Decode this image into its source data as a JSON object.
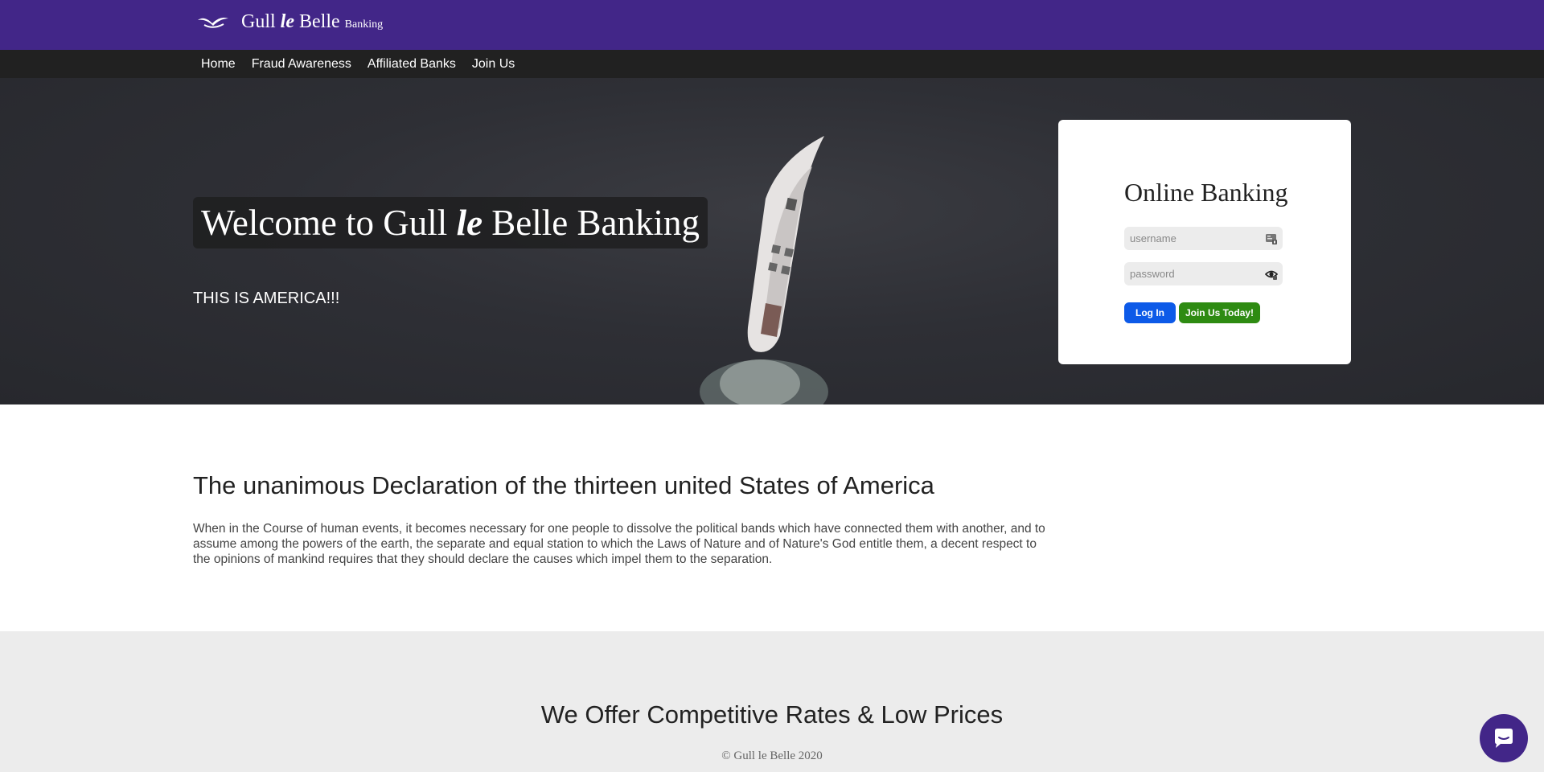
{
  "brand": {
    "name_part1": "Gull ",
    "name_le": "le",
    "name_part2": " Belle",
    "sub": "Banking"
  },
  "nav": {
    "items": [
      "Home",
      "Fraud Awareness",
      "Affiliated Banks",
      "Join Us"
    ]
  },
  "hero": {
    "welcome_part1": "Welcome to Gull ",
    "welcome_le": "le",
    "welcome_part2": " Belle Banking",
    "tagline": "THIS IS AMERICA!!!"
  },
  "login": {
    "title": "Online Banking",
    "username_placeholder": "username",
    "password_placeholder": "password",
    "login_label": "Log In",
    "join_label": "Join Us Today!"
  },
  "declaration": {
    "title": "The unanimous Declaration of the thirteen united States of America",
    "body": "When in the Course of human events, it becomes necessary for one people to dissolve the political bands which have connected them with another, and to assume among the powers of the earth, the separate and equal station to which the Laws of Nature and of Nature's God entitle them, a decent respect to the opinions of mankind requires that they should declare the causes which impel them to the separation."
  },
  "offer": {
    "title": "We Offer Competitive Rates & Low Prices",
    "copyright": "© Gull le Belle 2020"
  },
  "colors": {
    "brand_purple": "#422688",
    "nav_dark": "#212121",
    "login_blue": "#0d5ae8",
    "join_green": "#2e8b12"
  },
  "icons": {
    "brand": "gull-logo-icon",
    "username": "id-card-icon",
    "password": "eye-icon",
    "chat": "chat-bubble-icon"
  }
}
